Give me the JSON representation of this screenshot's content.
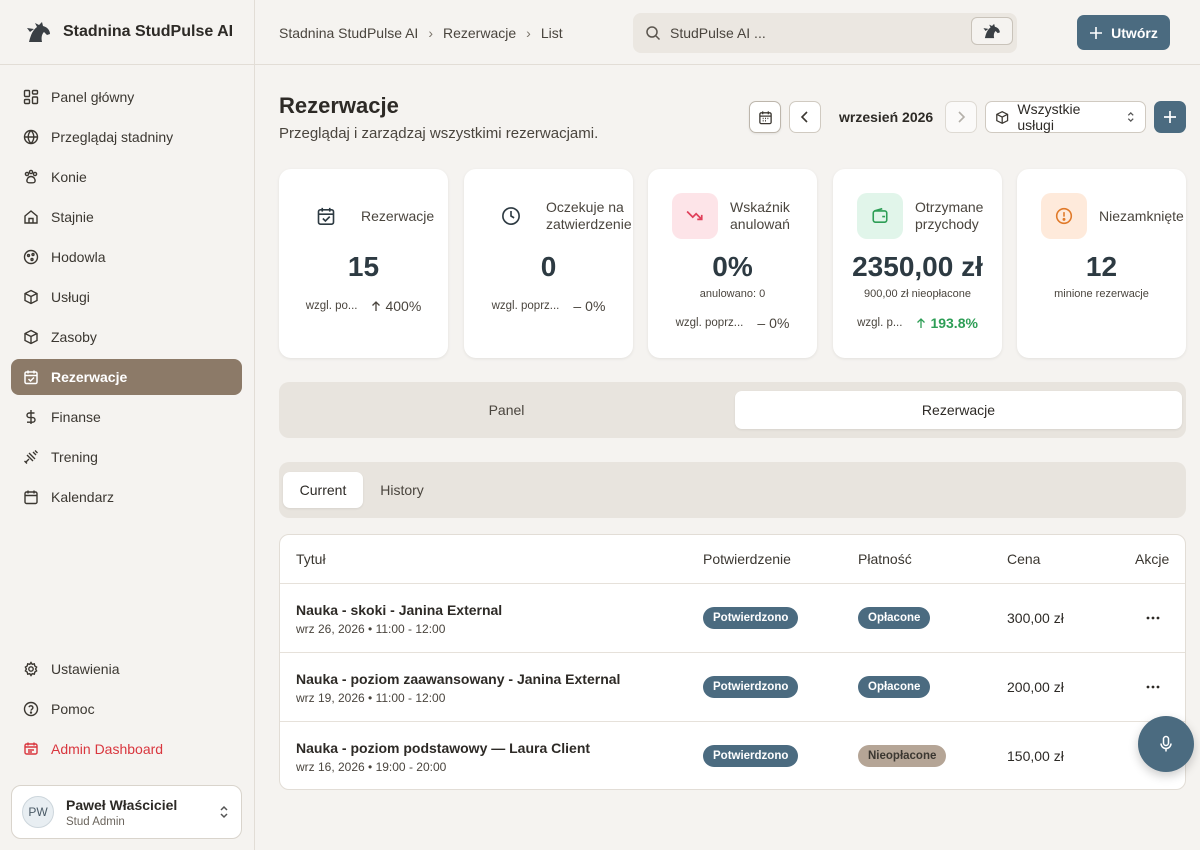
{
  "brand": {
    "name": "Stadnina StudPulse AI"
  },
  "sidebar": {
    "items": [
      {
        "label": "Panel główny",
        "icon": "dashboard-icon"
      },
      {
        "label": "Przeglądaj stadniny",
        "icon": "globe-icon"
      },
      {
        "label": "Konie",
        "icon": "paw-icon"
      },
      {
        "label": "Stajnie",
        "icon": "home-icon"
      },
      {
        "label": "Hodowla",
        "icon": "breeding-icon"
      },
      {
        "label": "Usługi",
        "icon": "package-icon"
      },
      {
        "label": "Zasoby",
        "icon": "box-icon"
      },
      {
        "label": "Rezerwacje",
        "icon": "calendar-check-icon",
        "active": true
      },
      {
        "label": "Finanse",
        "icon": "dollar-icon"
      },
      {
        "label": "Trening",
        "icon": "training-icon"
      },
      {
        "label": "Kalendarz",
        "icon": "calendar-icon"
      }
    ],
    "bottom": [
      {
        "label": "Ustawienia",
        "icon": "gear-icon"
      },
      {
        "label": "Pomoc",
        "icon": "help-icon"
      },
      {
        "label": "Admin Dashboard",
        "icon": "admin-icon"
      }
    ],
    "user": {
      "initials": "PW",
      "name": "Paweł Właściciel",
      "role": "Stud Admin"
    }
  },
  "topbar": {
    "breadcrumb": [
      "Stadnina StudPulse AI",
      "Rezerwacje",
      "List"
    ],
    "search_placeholder": "StudPulse AI ...",
    "create_label": "Utwórz"
  },
  "page": {
    "title": "Rezerwacje",
    "subtitle": "Przeglądaj i zarządzaj wszystkimi rezerwacjami.",
    "month": "wrzesień 2026",
    "service_filter": "Wszystkie usługi"
  },
  "stats": [
    {
      "label": "Rezerwacje",
      "value": "15",
      "cmp_label": "wzgl. po...",
      "delta": "400%"
    },
    {
      "label": "Oczekuje na zatwierdzenie",
      "value": "0",
      "cmp_label": "wzgl. poprz...",
      "delta": "0%"
    },
    {
      "label": "Wskaźnik anulowań",
      "value": "0%",
      "note": "anulowano: 0",
      "cmp_label": "wzgl. poprz...",
      "delta": "0%"
    },
    {
      "label": "Otrzymane przychody",
      "value": "2350,00 zł",
      "note": "900,00 zł nieopłacone",
      "cmp_label": "wzgl. p...",
      "delta": "193.8%"
    },
    {
      "label": "Niezamknięte",
      "value": "12",
      "note": "minione rezerwacje"
    }
  ],
  "view_tabs": [
    "Panel",
    "Rezerwacje"
  ],
  "sub_tabs": [
    "Current",
    "History"
  ],
  "table": {
    "headers": [
      "Tytuł",
      "Potwierdzenie",
      "Płatność",
      "Cena",
      "Akcje"
    ],
    "rows": [
      {
        "title": "Nauka - skoki - Janina External",
        "date": "wrz 26, 2026 • 11:00 - 12:00",
        "confirmation": "Potwierdzono",
        "payment": "Opłacone",
        "price": "300,00 zł"
      },
      {
        "title": "Nauka - poziom zaawansowany - Janina External",
        "date": "wrz 19, 2026 • 11:00 - 12:00",
        "confirmation": "Potwierdzono",
        "payment": "Opłacone",
        "price": "200,00 zł"
      },
      {
        "title": "Nauka - poziom podstawowy — Laura Client",
        "date": "wrz 16, 2026 • 19:00 - 20:00",
        "confirmation": "Potwierdzono",
        "payment": "Nieopłacone",
        "price": "150,00 zł"
      }
    ]
  },
  "colors": {
    "accent": "#4b6b80",
    "active_nav": "#8c7a68",
    "paid": "#4b6b80",
    "unpaid": "#b5a596",
    "positive": "#2e9e56",
    "danger": "#d9363e"
  }
}
